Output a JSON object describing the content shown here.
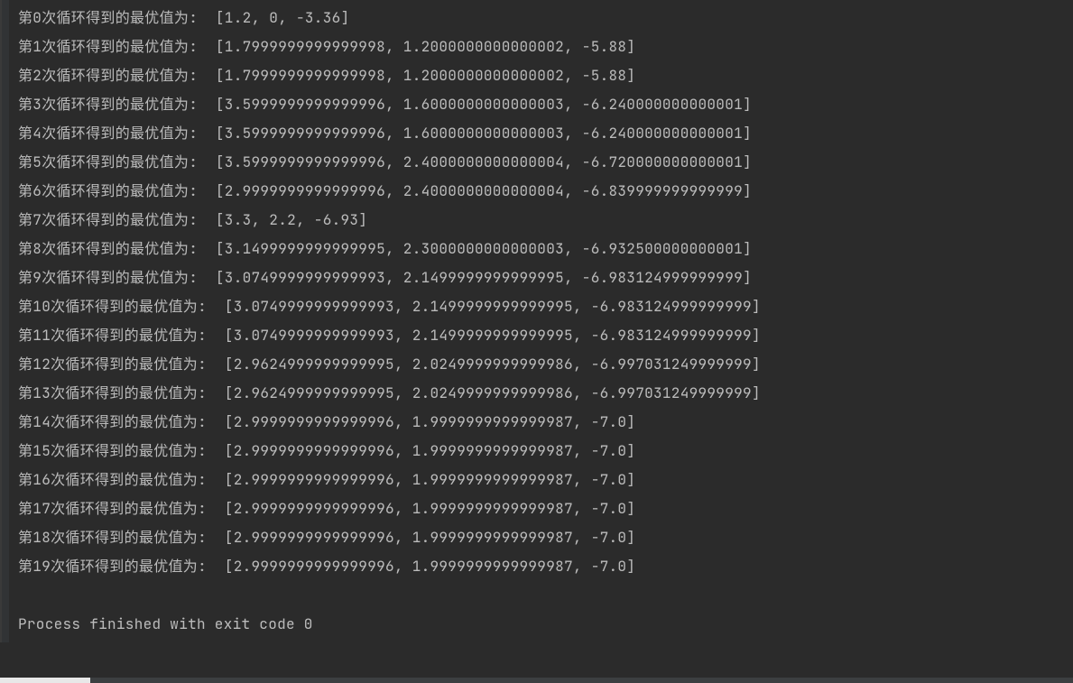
{
  "output_lines": [
    "第0次循环得到的最优值为:  [1.2, 0, -3.36]",
    "第1次循环得到的最优值为:  [1.7999999999999998, 1.2000000000000002, -5.88]",
    "第2次循环得到的最优值为:  [1.7999999999999998, 1.2000000000000002, -5.88]",
    "第3次循环得到的最优值为:  [3.5999999999999996, 1.6000000000000003, -6.240000000000001]",
    "第4次循环得到的最优值为:  [3.5999999999999996, 1.6000000000000003, -6.240000000000001]",
    "第5次循环得到的最优值为:  [3.5999999999999996, 2.4000000000000004, -6.720000000000001]",
    "第6次循环得到的最优值为:  [2.9999999999999996, 2.4000000000000004, -6.839999999999999]",
    "第7次循环得到的最优值为:  [3.3, 2.2, -6.93]",
    "第8次循环得到的最优值为:  [3.1499999999999995, 2.3000000000000003, -6.932500000000001]",
    "第9次循环得到的最优值为:  [3.0749999999999993, 2.1499999999999995, -6.983124999999999]",
    "第10次循环得到的最优值为:  [3.0749999999999993, 2.1499999999999995, -6.983124999999999]",
    "第11次循环得到的最优值为:  [3.0749999999999993, 2.1499999999999995, -6.983124999999999]",
    "第12次循环得到的最优值为:  [2.9624999999999995, 2.0249999999999986, -6.997031249999999]",
    "第13次循环得到的最优值为:  [2.9624999999999995, 2.0249999999999986, -6.997031249999999]",
    "第14次循环得到的最优值为:  [2.9999999999999996, 1.9999999999999987, -7.0]",
    "第15次循环得到的最优值为:  [2.9999999999999996, 1.9999999999999987, -7.0]",
    "第16次循环得到的最优值为:  [2.9999999999999996, 1.9999999999999987, -7.0]",
    "第17次循环得到的最优值为:  [2.9999999999999996, 1.9999999999999987, -7.0]",
    "第18次循环得到的最优值为:  [2.9999999999999996, 1.9999999999999987, -7.0]",
    "第19次循环得到的最优值为:  [2.9999999999999996, 1.9999999999999987, -7.0]"
  ],
  "exit_message": "Process finished with exit code 0"
}
